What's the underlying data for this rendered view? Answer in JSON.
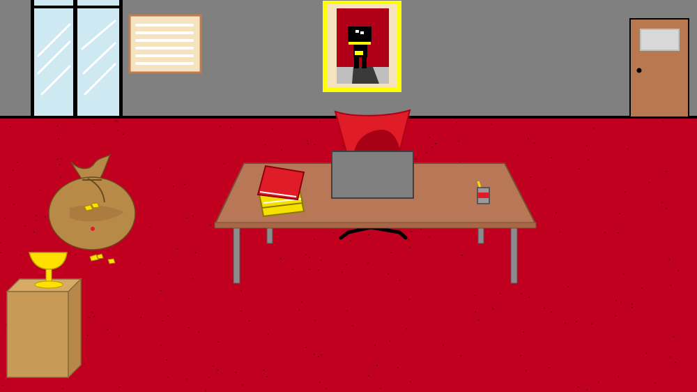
{
  "scene": {
    "name": "office",
    "colors": {
      "wall": "#808080",
      "floor": "#c0001e",
      "floor_speckle": "#3a0008",
      "baseboard": "#000000",
      "window_glass": "#cfe9f3",
      "window_frame": "#000000",
      "notice_board": "#f5e3c0",
      "notice_board_frame": "#c07c50",
      "portrait_frame": "#ffff00",
      "portrait_mat": "#f5e3c0",
      "portrait_background": "#b00018",
      "door": "#b87850",
      "door_plate": "#d9d9d9",
      "desk_top": "#b87858",
      "desk_legs": "#8c8c8c",
      "chair": "#e01c28",
      "laptop": "#808080",
      "book_red": "#e01c28",
      "book_yellow": "#f5e000",
      "cup": "#9a9a9a",
      "money_bag": "#b88a48",
      "gold": "#ffe000",
      "box": "#c89a58"
    },
    "objects": [
      {
        "id": "window",
        "icon": "window-icon",
        "interactable": true
      },
      {
        "id": "notice-board",
        "icon": "notice-board-icon",
        "interactable": true
      },
      {
        "id": "portrait",
        "icon": "portrait-icon",
        "interactable": true
      },
      {
        "id": "door",
        "icon": "door-icon",
        "interactable": true
      },
      {
        "id": "office-chair",
        "icon": "chair-icon",
        "interactable": true
      },
      {
        "id": "desk",
        "icon": "desk-icon",
        "interactable": true
      },
      {
        "id": "laptop",
        "icon": "laptop-icon",
        "interactable": true
      },
      {
        "id": "book-stack",
        "icon": "book-stack-icon",
        "interactable": true
      },
      {
        "id": "pencil-cup",
        "icon": "pencil-cup-icon",
        "interactable": true
      },
      {
        "id": "money-bag",
        "icon": "money-bag-icon",
        "interactable": true
      },
      {
        "id": "gold-coins",
        "icon": "gold-coins-icon",
        "interactable": true
      },
      {
        "id": "golden-goblet",
        "icon": "goblet-icon",
        "interactable": true
      },
      {
        "id": "cardboard-box",
        "icon": "box-icon",
        "interactable": true
      }
    ]
  }
}
